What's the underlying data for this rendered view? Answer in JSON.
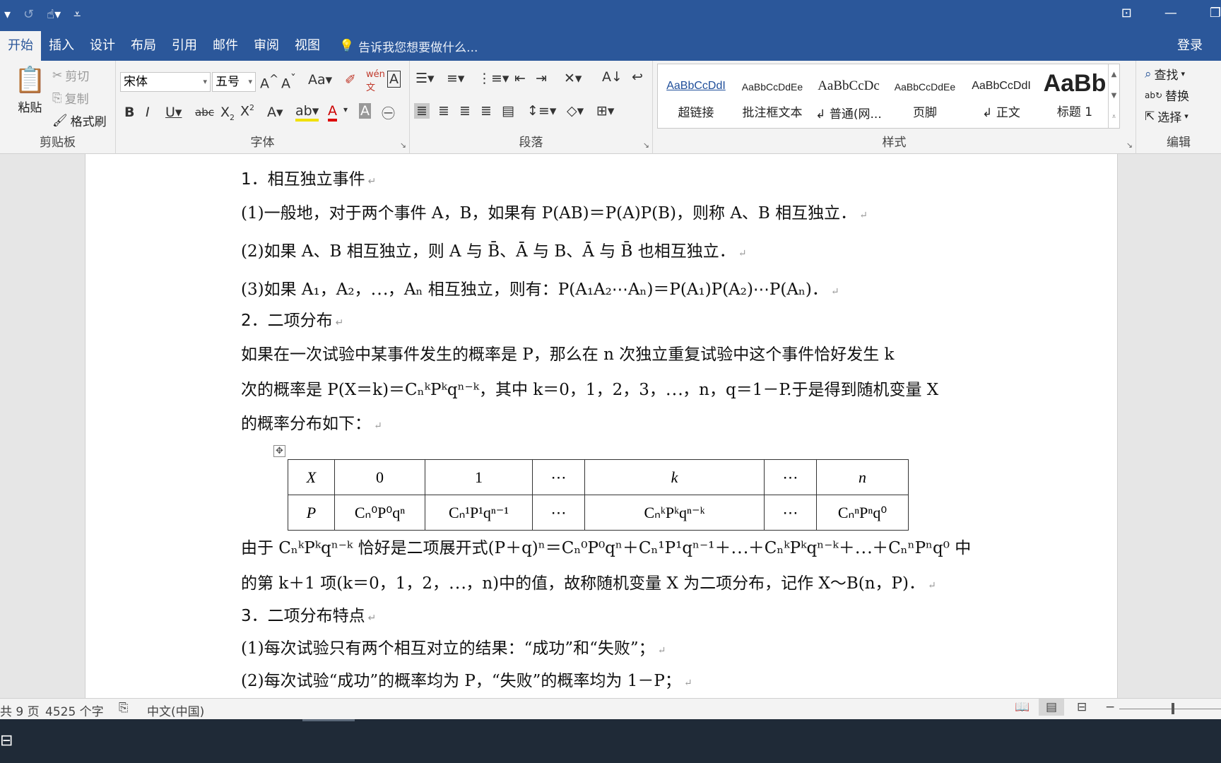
{
  "qat": {
    "undo_icon": "undo-icon",
    "touch_icon": "touch-mode-icon",
    "customize_icon": "customize-qat-icon"
  },
  "tabs": [
    "开始",
    "插入",
    "设计",
    "布局",
    "引用",
    "邮件",
    "审阅",
    "视图"
  ],
  "tell_me": "告诉我您想要做什么...",
  "login": "登录",
  "clipboard": {
    "paste": "粘贴",
    "cut": "剪切",
    "copy": "复制",
    "format_painter": "格式刷",
    "label": "剪贴板"
  },
  "font": {
    "name": "宋体",
    "size": "五号",
    "label": "字体"
  },
  "paragraph": {
    "label": "段落"
  },
  "styles": {
    "label": "样式",
    "items": [
      {
        "preview": "AaBbCcDdI",
        "name": "超链接"
      },
      {
        "preview": "AaBbCcDdEe",
        "name": "批注框文本"
      },
      {
        "preview": "AaBbCcDc",
        "name": "↲ 普通(网..."
      },
      {
        "preview": "AaBbCcDdEe",
        "name": "页脚"
      },
      {
        "preview": "AaBbCcDdI",
        "name": "↲ 正文"
      },
      {
        "preview": "AaBb",
        "name": "标题 1"
      }
    ]
  },
  "editing": {
    "find": "查找",
    "replace": "替换",
    "select": "选择",
    "label": "编辑"
  },
  "doc": {
    "h1": "1．相互独立事件",
    "p1": "(1)一般地，对于两个事件 A，B，如果有 P(AB)＝P(A)P(B)，则称 A、B 相互独立．",
    "p2": "(2)如果 A、B 相互独立，则 A 与 B̄、Ā 与 B、Ā 与 B̄ 也相互独立．",
    "p3": "(3)如果 A₁，A₂，⋯，Aₙ 相互独立，则有：P(A₁A₂⋯Aₙ)＝P(A₁)P(A₂)⋯P(Aₙ)．",
    "h2": "2．二项分布",
    "p4": "如果在一次试验中某事件发生的概率是 P，那么在 n 次独立重复试验中这个事件恰好发生 k",
    "p5": "次的概率是 P(X＝k)＝CₙᵏPᵏqⁿ⁻ᵏ，其中 k＝0，1，2，3，⋯，n，q＝1－P.于是得到随机变量 X",
    "p6": "的概率分布如下：",
    "table": [
      [
        "X",
        "0",
        "1",
        "⋯",
        "k",
        "⋯",
        "n"
      ],
      [
        "P",
        "Cₙ⁰P⁰qⁿ",
        "Cₙ¹P¹qⁿ⁻¹",
        "⋯",
        "CₙᵏPᵏqⁿ⁻ᵏ",
        "⋯",
        "CₙⁿPⁿq⁰"
      ]
    ],
    "p7": "由于 CₙᵏPᵏqⁿ⁻ᵏ 恰好是二项展开式(P＋q)ⁿ＝Cₙ⁰P⁰qⁿ＋Cₙ¹P¹qⁿ⁻¹＋⋯＋CₙᵏPᵏqⁿ⁻ᵏ＋⋯＋CₙⁿPⁿq⁰ 中",
    "p8": "的第 k＋1 项(k＝0，1，2，⋯，n)中的值，故称随机变量 X 为二项分布，记作 X～B(n，P)．",
    "h3": "3．二项分布特点",
    "p9": "(1)每次试验只有两个相互对立的结果：“成功”和“失败”；",
    "p10": "(2)每次试验“成功”的概率均为 P，“失败”的概率均为 1－P；"
  },
  "status": {
    "pages": "共 9 页",
    "words": "4525 个字",
    "lang": "中文(中国)"
  }
}
